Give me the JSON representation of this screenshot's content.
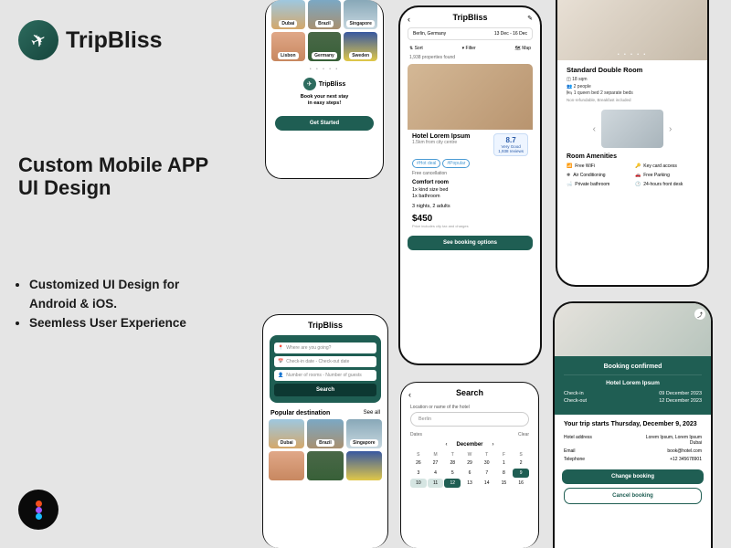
{
  "brand": {
    "name": "TripBliss"
  },
  "hero": {
    "headline_l1": "Custom Mobile APP",
    "headline_l2": "UI Design",
    "bullet1": "Customized UI Design for",
    "bullet1b": "Android & iOS.",
    "bullet2": "Seemless User Experience"
  },
  "screen1": {
    "destinations_r1": [
      "Dubai",
      "Brazil",
      "Singapore"
    ],
    "destinations_r2": [
      "Lisbon",
      "Germany",
      "Sweden"
    ],
    "tagline_l1": "Book your next stay",
    "tagline_l2": "in easy steps!",
    "cta": "Get Started"
  },
  "screen2": {
    "title": "TripBliss",
    "search_loc": "Berlin, Germany",
    "search_dates": "13 Dec - 16 Dec",
    "sort": "Sort",
    "filter": "Filter",
    "map": "Map",
    "count": "1,938 properties found",
    "hotel_name": "Hotel Lorem Ipsum",
    "hotel_dist": "1.5km from city centre",
    "score": "8.7",
    "score_label": "Very Good",
    "reviews": "1,938 reviews",
    "tag1": "#Hot deal",
    "tag2": "#Popular",
    "free": "Free cancellation",
    "room_type": "Comfort room",
    "room_d1": "1x kind size bed",
    "room_d2": "1x bathroom",
    "stay": "3 nights, 2 adults",
    "price": "$450",
    "disclaimer": "Price includes city tax and charges",
    "cta": "See booking options"
  },
  "screen3": {
    "title": "Standard Double Room",
    "spec1": "18 sqm",
    "spec2": "2 people",
    "spec3": "1 queen bed 2 separate beds",
    "spec4": "Non-refundable, Breakfast included",
    "amen_title": "Room Amenities",
    "a1": "Free WiFi",
    "a2": "Key card access",
    "a3": "Air Conditioning",
    "a4": "Free Parking",
    "a5": "Private bathroom",
    "a6": "24-hours front desk"
  },
  "screen4": {
    "title": "TripBliss",
    "ph_where": "Where are you going?",
    "ph_dates": "Check-in date - Check-out date",
    "ph_guests": "Number of rooms - Number of guests",
    "search": "Search",
    "popular": "Popular destination",
    "seeall": "See all",
    "destinations": [
      "Dubai",
      "Brazil",
      "Singapore"
    ]
  },
  "screen5": {
    "title": "Search",
    "loc_label": "Location or name of the hotel",
    "loc_value": "Berlin",
    "dates": "Dates",
    "clear": "Clear",
    "month": "December",
    "dows": [
      "S",
      "M",
      "T",
      "W",
      "T",
      "F",
      "S"
    ],
    "days": [
      "26",
      "27",
      "28",
      "29",
      "30",
      "1",
      "2",
      "3",
      "4",
      "5",
      "6",
      "7",
      "8",
      "9",
      "10",
      "11",
      "12",
      "13",
      "14",
      "15",
      "16"
    ],
    "sel_start": "9",
    "sel_end": "12"
  },
  "screen6": {
    "confirmed": "Booking confirmed",
    "hotel": "Hotel Lorem Ipsum",
    "checkin_l": "Check-in",
    "checkin_v": "09 December 2023",
    "checkout_l": "Check-out",
    "checkout_v": "12 December 2023",
    "trip_start": "Your trip starts Thursday, December 9, 2023",
    "addr_l": "Hotel address",
    "addr_v": "Lorem Ipsum, Lorem Ipsum Dubai",
    "email_l": "Email",
    "email_v": "book@hotel.com",
    "tel_l": "Telephone",
    "tel_v": "+12 345678901",
    "change": "Change booking",
    "cancel": "Cancel booking"
  }
}
